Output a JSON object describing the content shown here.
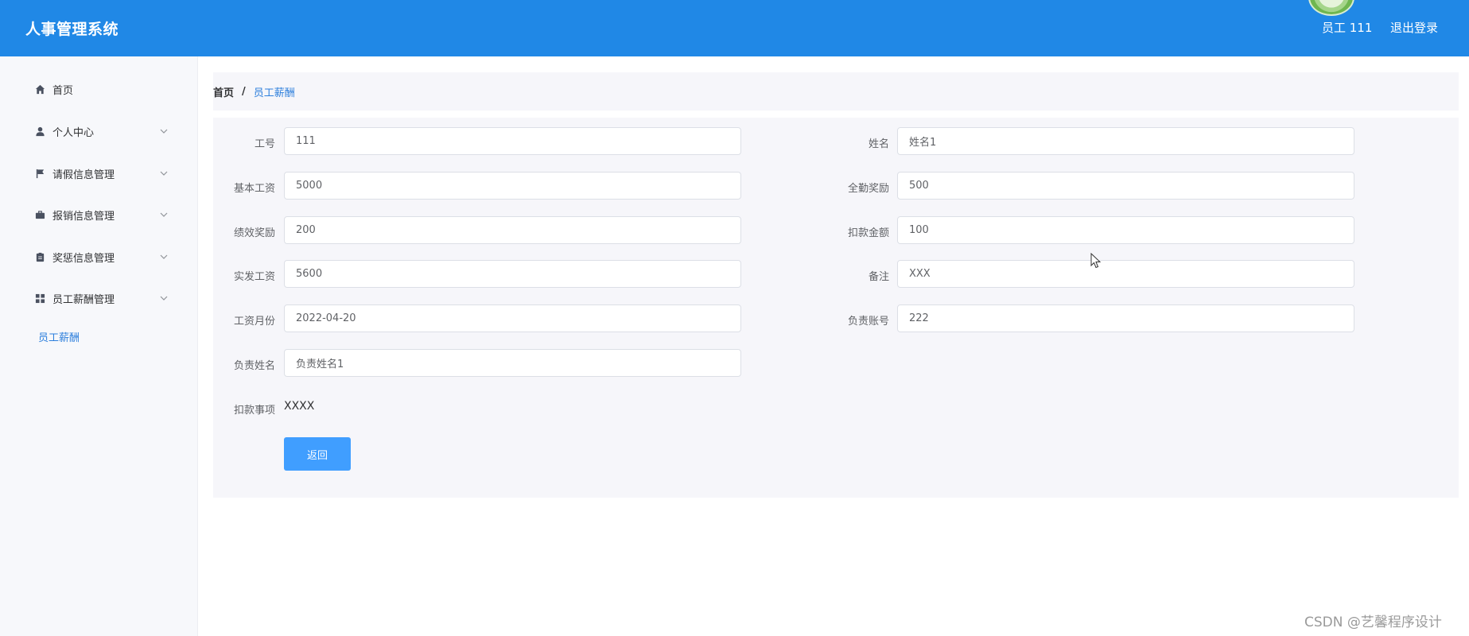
{
  "header": {
    "app_title": "人事管理系统",
    "user_label": "员工 111",
    "logout_label": "退出登录",
    "brand_color": "#2088e6"
  },
  "sidebar": {
    "items": [
      {
        "label": "首页",
        "icon": "home-icon",
        "expandable": false
      },
      {
        "label": "个人中心",
        "icon": "user-icon",
        "expandable": true
      },
      {
        "label": "请假信息管理",
        "icon": "flag-icon",
        "expandable": true
      },
      {
        "label": "报销信息管理",
        "icon": "briefcase-icon",
        "expandable": true
      },
      {
        "label": "奖惩信息管理",
        "icon": "clipboard-icon",
        "expandable": true
      },
      {
        "label": "员工薪酬管理",
        "icon": "grid-icon",
        "expandable": true
      }
    ],
    "sub_item": {
      "label": "员工薪酬",
      "color": "#2d7fdc"
    }
  },
  "breadcrumb": {
    "home": "首页",
    "separator": "/",
    "current": "员工薪酬"
  },
  "form": {
    "employee_id": {
      "label": "工号",
      "value": "111"
    },
    "name": {
      "label": "姓名",
      "value": "姓名1"
    },
    "base_salary": {
      "label": "基本工资",
      "value": "5000"
    },
    "attendance_bonus": {
      "label": "全勤奖励",
      "value": "500"
    },
    "performance_bonus": {
      "label": "绩效奖励",
      "value": "200"
    },
    "deduction_amount": {
      "label": "扣款金额",
      "value": "100"
    },
    "net_salary": {
      "label": "实发工资",
      "value": "5600"
    },
    "remark": {
      "label": "备注",
      "value": "XXX"
    },
    "salary_month": {
      "label": "工资月份",
      "value": "2022-04-20"
    },
    "manager_account": {
      "label": "负责账号",
      "value": "222"
    },
    "manager_name": {
      "label": "负责姓名",
      "value": "负责姓名1"
    },
    "deduction_item": {
      "label": "扣款事项",
      "value": "XXXX"
    },
    "back_label": "返回"
  },
  "watermark": "CSDN @艺馨程序设计"
}
